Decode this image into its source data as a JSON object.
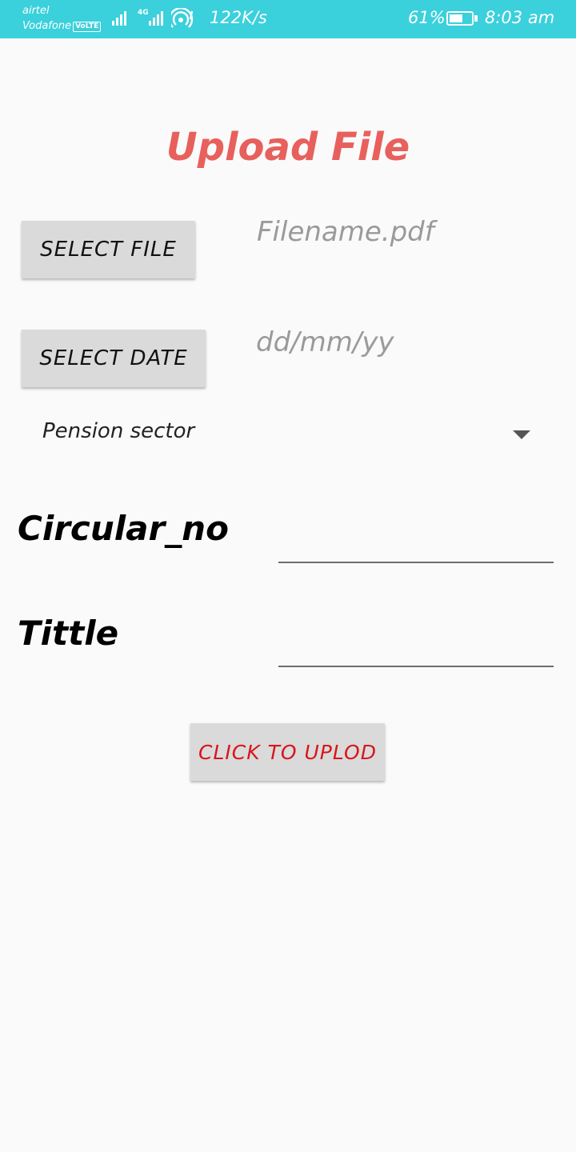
{
  "status_bar": {
    "carrier1": "airtel",
    "carrier2": "Vodafone",
    "volte": "VoLTE",
    "network_type": "4G",
    "speed": "122K/s",
    "battery_percent": "61%",
    "battery_level": 0.61,
    "time": "8:03 am",
    "colors": {
      "background": "#3ad0dc",
      "foreground": "#ffffff"
    }
  },
  "page": {
    "title": "Upload File",
    "title_color": "#e8605c"
  },
  "file_section": {
    "select_file_label": "SELECT FILE",
    "filename_hint": "Filename.pdf"
  },
  "date_section": {
    "select_date_label": "SELECT DATE",
    "date_hint": "dd/mm/yy"
  },
  "sector_dropdown": {
    "selected": "Pension sector",
    "icon": "dropdown-arrow-icon"
  },
  "fields": {
    "circular_label": "Circular_no",
    "circular_value": "",
    "tittle_label": "Tittle",
    "tittle_value": ""
  },
  "upload": {
    "label": "CLICK TO UPLOD",
    "color": "#d8151d"
  }
}
